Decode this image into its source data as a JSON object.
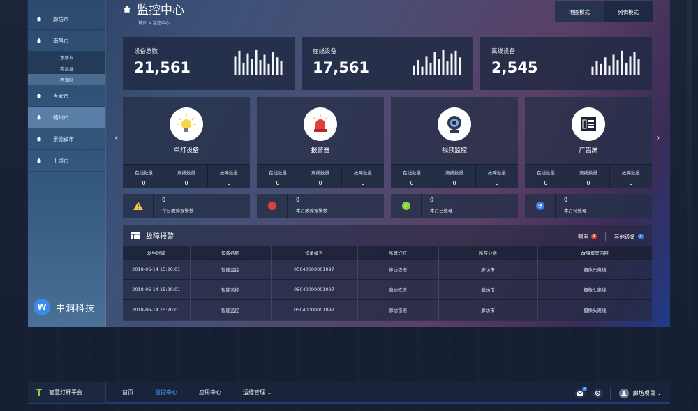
{
  "sidebar": {
    "top_label": "",
    "items": [
      {
        "label": "廊坊市"
      },
      {
        "label": "南昌市"
      },
      {
        "label": "吉安市"
      },
      {
        "label": "赣州市"
      },
      {
        "label": "景德镇市"
      },
      {
        "label": "上饶市"
      }
    ],
    "subitems": [
      "东新乡",
      "南昌县",
      "西湖区"
    ],
    "brand_name": "中洞科技",
    "brand_logo": "W"
  },
  "header": {
    "title": "监控中心",
    "breadcrumb": "首页 > 监控中心",
    "mode_map": "地图模式",
    "mode_list": "列表模式"
  },
  "stats": [
    {
      "label": "设备总数",
      "value": "21,561",
      "bars": [
        0.7,
        0.9,
        0.45,
        0.8,
        0.6,
        0.95,
        0.55,
        0.75,
        0.4,
        0.85,
        0.65,
        0.5
      ]
    },
    {
      "label": "在线设备",
      "value": "17,561",
      "bars": [
        0.35,
        0.55,
        0.3,
        0.7,
        0.45,
        0.85,
        0.6,
        0.95,
        0.5,
        0.8,
        0.9,
        0.65
      ]
    },
    {
      "label": "离线设备",
      "value": "2,545",
      "bars": [
        0.3,
        0.5,
        0.4,
        0.65,
        0.35,
        0.75,
        0.55,
        0.9,
        0.45,
        0.7,
        0.85,
        0.6
      ]
    }
  ],
  "devices": [
    {
      "name": "单灯设备",
      "icon": "bulb-icon",
      "counts": [
        {
          "label": "在线数量",
          "value": "0"
        },
        {
          "label": "离线数量",
          "value": "0"
        },
        {
          "label": "故障数量",
          "value": "0"
        }
      ]
    },
    {
      "name": "报警器",
      "icon": "alarm-icon",
      "counts": [
        {
          "label": "在线数量",
          "value": "0"
        },
        {
          "label": "离线数量",
          "value": "0"
        },
        {
          "label": "故障数量",
          "value": "0"
        }
      ]
    },
    {
      "name": "视频监控",
      "icon": "camera-icon",
      "counts": [
        {
          "label": "在线数量",
          "value": "0"
        },
        {
          "label": "离线数量",
          "value": "0"
        },
        {
          "label": "故障数量",
          "value": "0"
        }
      ]
    },
    {
      "name": "广告屏",
      "icon": "screen-icon",
      "counts": [
        {
          "label": "在线数量",
          "value": "0"
        },
        {
          "label": "离线数量",
          "value": "0"
        },
        {
          "label": "故障数量",
          "value": "0"
        }
      ]
    }
  ],
  "alerts": [
    {
      "value": "0",
      "label": "今日故障报警数",
      "color": "#f2c94c",
      "icon": "warning-icon"
    },
    {
      "value": "0",
      "label": "本月故障报警数",
      "color": "#e0403a",
      "icon": "alarm-dot-icon"
    },
    {
      "value": "0",
      "label": "本月已处理",
      "color": "#8bd23a",
      "icon": "check-icon"
    },
    {
      "value": "0",
      "label": "本月待处理",
      "color": "#3b7be6",
      "icon": "clock-icon"
    }
  ],
  "fault": {
    "title": "故障报警",
    "tab_lighting": "照明",
    "tab_lighting_count": "4",
    "tab_other": "其他设备",
    "tab_other_count": "4",
    "columns": [
      "发生时间",
      "设备名称",
      "设备编号",
      "所属灯杆",
      "所在分组",
      "故障报警内容"
    ],
    "rows": [
      [
        "2018-06-14  15:20:01",
        "智能监控",
        "05040000001097",
        "廊坊铁塔",
        "廊坊市",
        "摄像头离线"
      ],
      [
        "2018-06-14  15:20:01",
        "智能监控",
        "05040000001097",
        "廊坊铁塔",
        "廊坊市",
        "摄像头离线"
      ],
      [
        "2018-06-14  15:20:01",
        "智能监控",
        "05040000001097",
        "廊坊铁塔",
        "廊坊市",
        "摄像头离线"
      ]
    ]
  },
  "topnav": {
    "platform": "智慧灯杆平台",
    "items": [
      "首页",
      "监控中心",
      "应用中心",
      "运维管理 ⌄"
    ],
    "message_count": "8",
    "user": "廊坊项目 ⌄"
  },
  "colors": {
    "accent": "#4aa3ff",
    "danger": "#e0403a"
  }
}
